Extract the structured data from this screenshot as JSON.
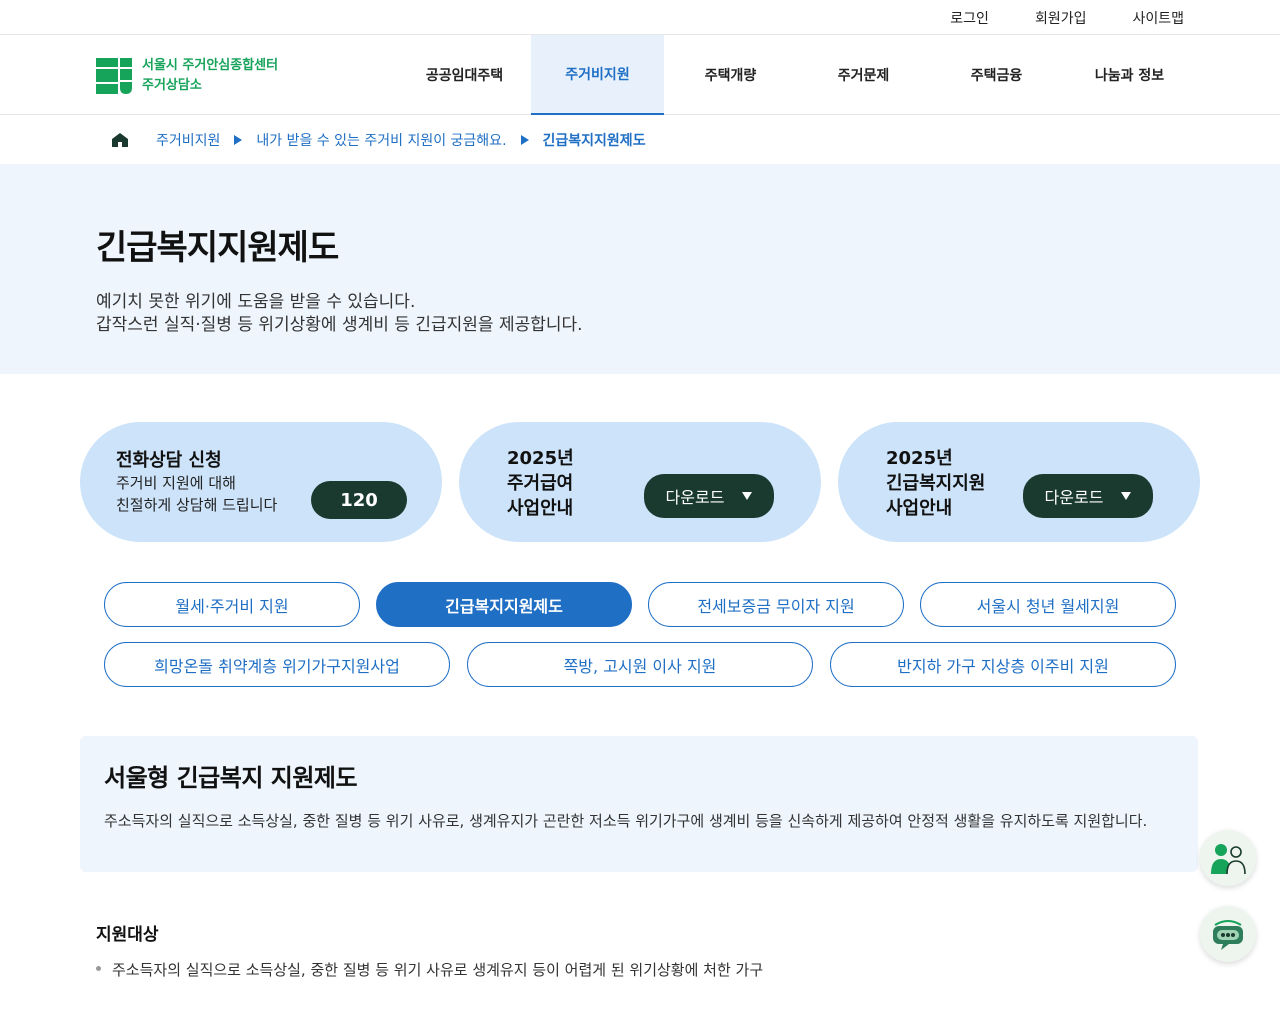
{
  "util": {
    "login": "로그인",
    "join": "회원가입",
    "sitemap": "사이트맵"
  },
  "logo": {
    "line1": "서울시 주거안심종합센터",
    "line2": "주거상담소"
  },
  "gnb": [
    "공공임대주택",
    "주거비지원",
    "주택개량",
    "주거문제",
    "주택금융",
    "나눔과 정보"
  ],
  "breadcrumb": [
    "주거비지원",
    "내가 받을 수 있는 주거비 지원이 궁금해요.",
    "긴급복지지원제도"
  ],
  "hero": {
    "title": "긴급복지지원제도",
    "desc1": "예기치 못한 위기에 도움을 받을 수 있습니다.",
    "desc2": "갑작스런 실직·질병 등 위기상황에 생계비 등 긴급지원을 제공합니다."
  },
  "cards": {
    "phone": {
      "title": "전화상담 신청",
      "desc1": "주거비 지원에 대해",
      "desc2": "친절하게 상담해 드립니다",
      "number": "120"
    },
    "housing": {
      "year": "2025년",
      "line1": "주거급여",
      "line2": "사업안내",
      "button": "다운로드"
    },
    "welfare": {
      "year": "2025년",
      "line1": "긴급복지지원",
      "line2": "사업안내",
      "button": "다운로드"
    }
  },
  "tabs": {
    "row1": [
      "월세·주거비 지원",
      "긴급복지지원제도",
      "전세보증금 무이자 지원",
      "서울시 청년 월세지원"
    ],
    "row2": [
      "희망온돌 취약계층 위기가구지원사업",
      "쪽방, 고시원 이사 지원",
      "반지하 가구 지상층 이주비 지원"
    ]
  },
  "info": {
    "title": "서울형 긴급복지 지원제도",
    "body": "주소득자의 실직으로 소득상실, 중한 질병 등 위기 사유로, 생계유지가 곤란한 저소득 위기가구에 생계비 등을 신속하게 제공하여 안정적 생활을 유지하도록 지원합니다."
  },
  "target": {
    "title": "지원대상",
    "item1": "주소득자의 실직으로 소득상실, 중한 질병 등 위기 사유로 생계유지 등이 어렵게 된 위기상황에 처한 가구"
  },
  "colors": {
    "brand_green": "#16a35a",
    "primary_blue": "#1f6fc5",
    "dark_pill": "#1a3a2f",
    "card_bg": "#cde3f9",
    "hero_bg": "#eef5fd"
  },
  "icons": {
    "home": "home-icon",
    "people": "people-icon",
    "chatbot": "chatbot-icon"
  }
}
